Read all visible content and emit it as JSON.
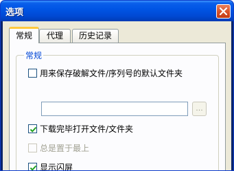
{
  "window": {
    "title": "选项"
  },
  "tabs": [
    {
      "label": "常规",
      "active": true
    },
    {
      "label": "代理",
      "active": false
    },
    {
      "label": "历史记录",
      "active": false
    }
  ],
  "group": {
    "title": "常规"
  },
  "options": {
    "save_folder": {
      "label": "用来保存破解文件/序列号的默认文件夹",
      "checked": false,
      "enabled": true
    },
    "path_input": {
      "value": "",
      "placeholder": ""
    },
    "browse_label": "...",
    "open_after_download": {
      "label": "下载完毕打开文件/文件夹",
      "checked": true,
      "enabled": true
    },
    "always_on_top": {
      "label": "总是置于最上",
      "checked": false,
      "enabled": false
    },
    "show_splash": {
      "label": "显示闪屏",
      "checked": true,
      "enabled": true
    }
  },
  "colors": {
    "title_bar": "#0055e5",
    "active_tab_accent": "#ffc83c",
    "group_title": "#0046d5",
    "check_mark": "#21a121"
  }
}
